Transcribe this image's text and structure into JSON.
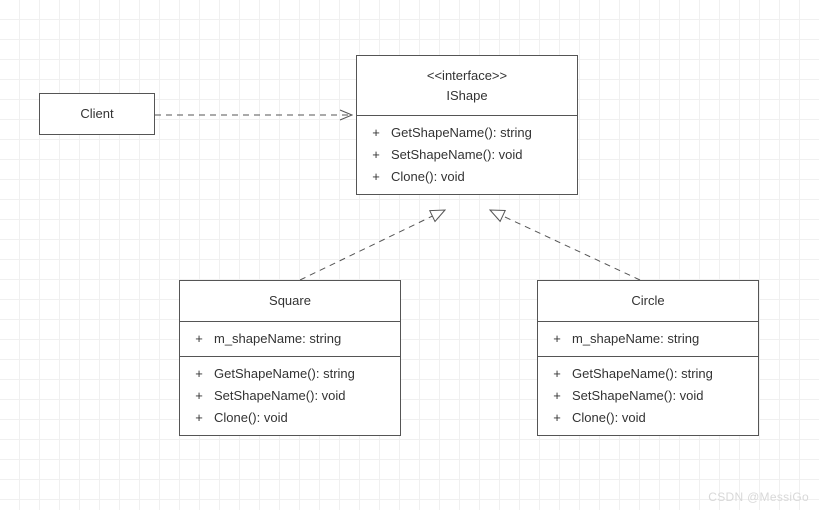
{
  "diagram": {
    "client": {
      "title": "Client"
    },
    "ishape": {
      "stereotype": "<<interface>>",
      "title": "IShape",
      "operations": [
        {
          "vis": "+",
          "sig": "GetShapeName(): string"
        },
        {
          "vis": "+",
          "sig": "SetShapeName(): void"
        },
        {
          "vis": "+",
          "sig": "Clone(): void"
        }
      ]
    },
    "square": {
      "title": "Square",
      "attributes": [
        {
          "vis": "+",
          "sig": "m_shapeName: string"
        }
      ],
      "operations": [
        {
          "vis": "+",
          "sig": "GetShapeName(): string"
        },
        {
          "vis": "+",
          "sig": "SetShapeName(): void"
        },
        {
          "vis": "+",
          "sig": "Clone(): void"
        }
      ]
    },
    "circle": {
      "title": "Circle",
      "attributes": [
        {
          "vis": "+",
          "sig": "m_shapeName: string"
        }
      ],
      "operations": [
        {
          "vis": "+",
          "sig": "GetShapeName(): string"
        },
        {
          "vis": "+",
          "sig": "SetShapeName(): void"
        },
        {
          "vis": "+",
          "sig": "Clone(): void"
        }
      ]
    },
    "relations": {
      "client_to_ishape": "dependency",
      "square_to_ishape": "realization",
      "circle_to_ishape": "realization"
    }
  },
  "watermark": "CSDN @MessiGo"
}
